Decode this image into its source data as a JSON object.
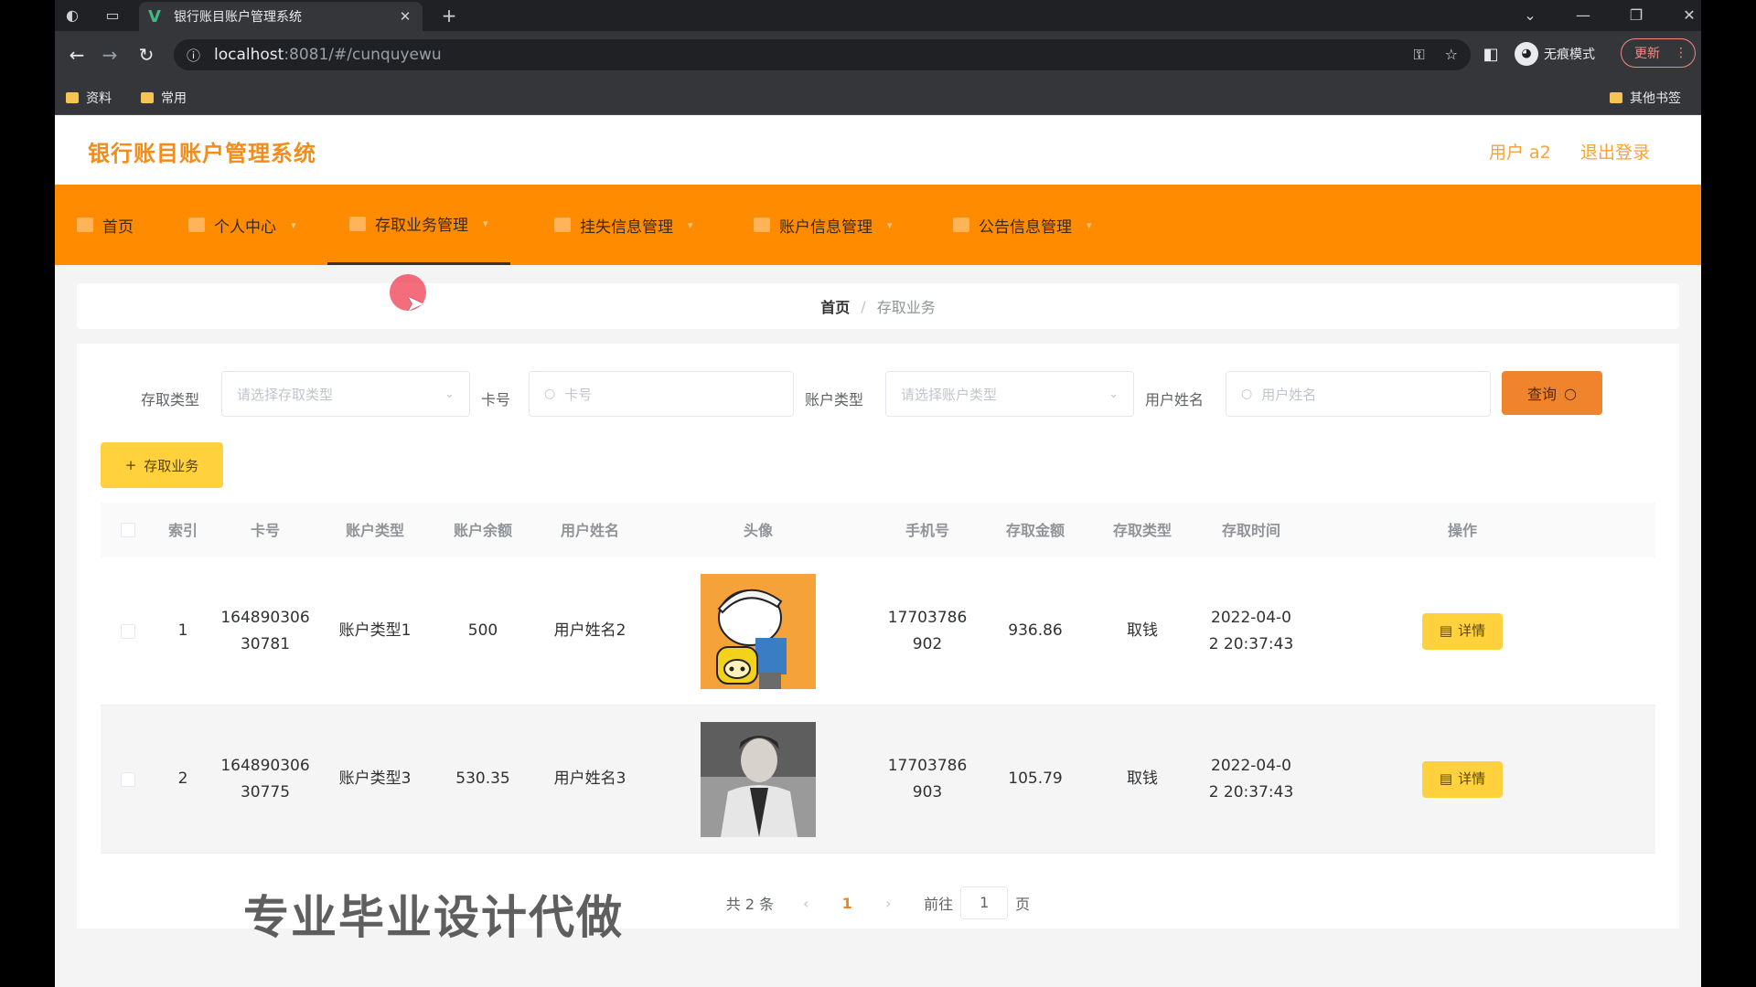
{
  "browser": {
    "tab_title": "银行账目账户管理系统",
    "url_host": "localhost",
    "url_rest": ":8081/#/cunquyewu",
    "incognito_label": "无痕模式",
    "update_label": "更新",
    "bookmarks": [
      "资料",
      "常用"
    ],
    "other_bookmarks": "其他书签"
  },
  "app": {
    "title": "银行账目账户管理系统",
    "user_label": "用户 a2",
    "logout_label": "退出登录"
  },
  "nav": {
    "items": [
      "首页",
      "个人中心",
      "存取业务管理",
      "挂失信息管理",
      "账户信息管理",
      "公告信息管理"
    ]
  },
  "breadcrumb": {
    "home": "首页",
    "sep": "/",
    "current": "存取业务"
  },
  "filters": {
    "type_label": "存取类型",
    "type_placeholder": "请选择存取类型",
    "card_label": "卡号",
    "card_placeholder": "卡号",
    "account_type_label": "账户类型",
    "account_type_placeholder": "请选择账户类型",
    "name_label": "用户姓名",
    "name_placeholder": "用户姓名",
    "query_button": "查询"
  },
  "add_button": "存取业务",
  "table": {
    "headers": [
      "索引",
      "卡号",
      "账户类型",
      "账户余额",
      "用户姓名",
      "头像",
      "手机号",
      "存取金额",
      "存取类型",
      "存取时间",
      "操作"
    ],
    "rows": [
      {
        "index": "1",
        "card_a": "164890306",
        "card_b": "30781",
        "account_type": "账户类型1",
        "balance": "500",
        "name": "用户姓名2",
        "phone_a": "17703786",
        "phone_b": "902",
        "amount": "936.86",
        "kind": "取钱",
        "time_a": "2022-04-0",
        "time_b": "2 20:37:43",
        "action": "详情"
      },
      {
        "index": "2",
        "card_a": "164890306",
        "card_b": "30775",
        "account_type": "账户类型3",
        "balance": "530.35",
        "name": "用户姓名3",
        "phone_a": "17703786",
        "phone_b": "903",
        "amount": "105.79",
        "kind": "取钱",
        "time_a": "2022-04-0",
        "time_b": "2 20:37:43",
        "action": "详情"
      }
    ]
  },
  "pagination": {
    "total": "共 2 条",
    "current": "1",
    "goto_label": "前往",
    "goto_value": "1",
    "page_unit": "页"
  },
  "watermark": "专业毕业设计代做",
  "colors": {
    "accent": "#ff8c00",
    "title": "#f28c1b",
    "button": "#ffd23d"
  }
}
